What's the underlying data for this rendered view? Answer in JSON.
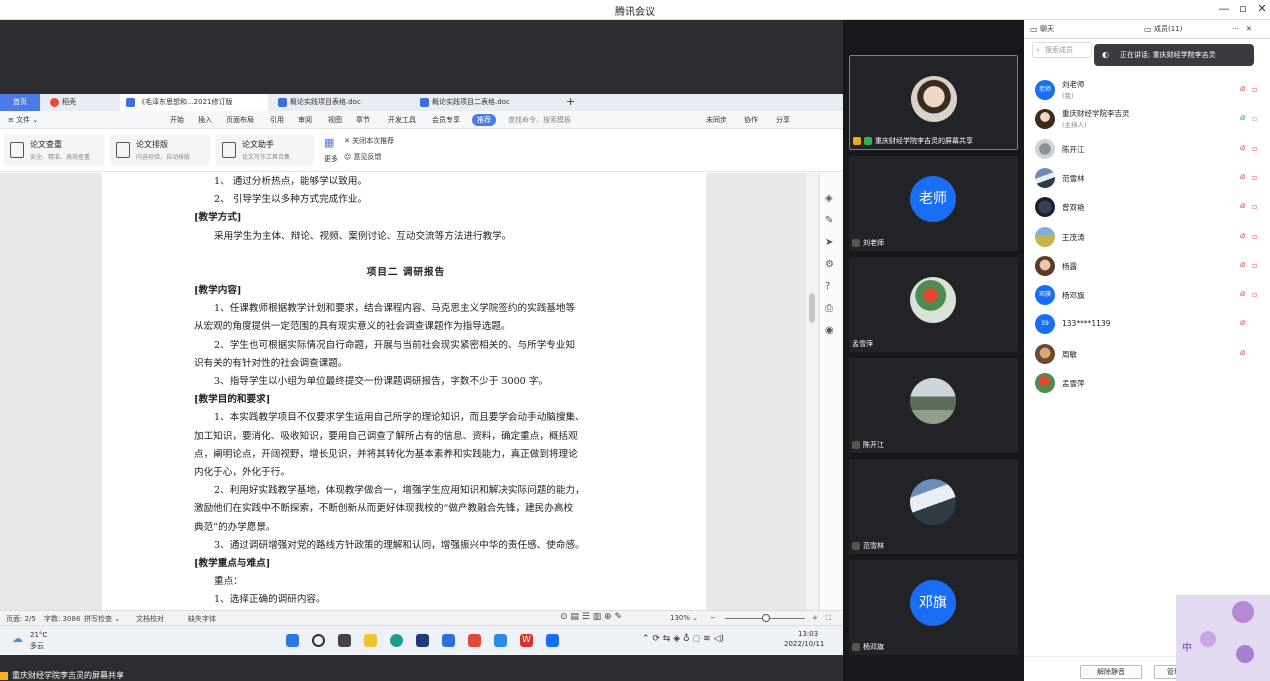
{
  "window": {
    "title": "腾讯会议",
    "controls": {
      "minimize": "—",
      "restore": "▫",
      "close": "✕"
    }
  },
  "wps": {
    "tabs": [
      {
        "label": "首页"
      },
      {
        "label": "稻壳"
      },
      {
        "label": "《毛泽东思想和...2021修订版"
      },
      {
        "label": "概论实践项目表格.doc"
      },
      {
        "label": "概论实践项目二表格.doc"
      }
    ],
    "add_tab": "+",
    "menu": {
      "file": "≡ 文件 ⌄",
      "items": [
        "开始",
        "插入",
        "页面布局",
        "引用",
        "审阅",
        "视图",
        "章节",
        "开发工具",
        "会员专享"
      ],
      "recommend": "推荐",
      "search": "查找命令、搜索模板",
      "sync": "未同步",
      "collab": "协作",
      "share": "分享"
    },
    "ribbon": {
      "btn1_title": "论文查重",
      "btn1_sub": "安全、精准、高效查重",
      "btn2_title": "论文排版",
      "btn2_sub": "内容校验，自动排版",
      "btn3_title": "论文助手",
      "btn3_sub": "论文写作工具合集",
      "more": "更多",
      "close_rec": "关闭本次推荐",
      "feedback": "意见反馈"
    },
    "doc_lines": [
      {
        "text": "1、 通过分析热点，能够学以致用。",
        "cls": "ind"
      },
      {
        "text": "2、 引导学生以多种方式完成作业。",
        "cls": "ind"
      },
      {
        "text": "[教学方式]",
        "cls": "h"
      },
      {
        "text": "采用学生为主体、辩论、视频、案例讨论、互动交流等方法进行教学。",
        "cls": "ind"
      },
      {
        "text": "",
        "cls": "blank"
      },
      {
        "text": "项目二        调研报告",
        "cls": "ctr"
      },
      {
        "text": "[教学内容]",
        "cls": "h"
      },
      {
        "text": "1、任课教师根据教学计划和要求，结合课程内容、马克思主义学院签约的实践基地等",
        "cls": "ind"
      },
      {
        "text": "从宏观的角度提供一定范围的具有现实意义的社会调查课题作为指导选题。",
        "cls": ""
      },
      {
        "text": "2、学生也可根据实际情况自行命题，开展与当前社会现实紧密相关的、与所学专业知",
        "cls": "ind"
      },
      {
        "text": "识有关的有针对性的社会调查课题。",
        "cls": ""
      },
      {
        "text": "3、指导学生以小组为单位最终提交一份课题调研报告，字数不少于 3000 字。",
        "cls": "ind"
      },
      {
        "text": "[教学目的和要求]",
        "cls": "h"
      },
      {
        "text": "1、本实践教学项目不仅要求学生运用自己所学的理论知识，而且要学会动手动脑搜集、",
        "cls": "ind"
      },
      {
        "text": "加工知识，要消化、吸收知识，要用自己调查了解所占有的信息、资料，确定重点，概括观",
        "cls": ""
      },
      {
        "text": "点，阐明论点，开阔视野，增长见识，并将其转化为基本素养和实践能力，真正做到将理论",
        "cls": ""
      },
      {
        "text": "内化于心，外化于行。",
        "cls": ""
      },
      {
        "text": "2、利用好实践教学基地，体现教学做合一，增强学生应用知识和解决实际问题的能力，",
        "cls": "ind"
      },
      {
        "text": "激励他们在实践中不断探索，不断创新从而更好体现我校的“做产教融合先锋，建民办高校",
        "cls": ""
      },
      {
        "text": "典范”的办学愿景。",
        "cls": ""
      },
      {
        "text": "3、通过调研增强对党的路线方针政策的理解和认同，增强振兴中华的责任感、使命感。",
        "cls": "ind"
      },
      {
        "text": "[教学重点与难点]",
        "cls": "h"
      },
      {
        "text": "重点：",
        "cls": "ind"
      },
      {
        "text": "1、选择正确的调研内容。",
        "cls": "ind"
      }
    ],
    "status": {
      "page": "页面: 2/5",
      "words": "字数: 3086",
      "spell": "拼写检查 ⌄",
      "proof": "文档校对",
      "font": "缺失字体",
      "zoom": "130% ⌄"
    }
  },
  "taskbar": {
    "temp": "21°C",
    "weather": "多云",
    "time": "13:03",
    "date": "2022/10/11"
  },
  "share_caption": "重庆财经学院李吉灵的屏幕共享",
  "videos": [
    {
      "name": "重庆财经学院李吉灵的屏幕共享",
      "avatar_text": ""
    },
    {
      "name": "刘老师",
      "avatar_text": "老师"
    },
    {
      "name": "孟雪萍",
      "avatar_text": ""
    },
    {
      "name": "陈开江",
      "avatar_text": ""
    },
    {
      "name": "范雪林",
      "avatar_text": ""
    },
    {
      "name": "杨邓旗",
      "avatar_text": "邓旗"
    }
  ],
  "panel": {
    "tab_chat": "聊天",
    "tab_members": "成员(11)",
    "more": "···",
    "close": "✕",
    "search_placeholder": "搜索成员",
    "speaking": "正在讲话: 重庆财经学院李吉灵",
    "members": [
      {
        "name": "刘老师",
        "sub": "(我)",
        "avatar_text": "老师"
      },
      {
        "name": "重庆财经学院李吉灵",
        "sub": "(主持人)",
        "avatar_text": ""
      },
      {
        "name": "陈开江",
        "sub": "",
        "avatar_text": ""
      },
      {
        "name": "范雪林",
        "sub": "",
        "avatar_text": ""
      },
      {
        "name": "曾双艳",
        "sub": "",
        "avatar_text": ""
      },
      {
        "name": "王茂涛",
        "sub": "",
        "avatar_text": ""
      },
      {
        "name": "杨露",
        "sub": "",
        "avatar_text": ""
      },
      {
        "name": "杨邓旗",
        "sub": "",
        "avatar_text": "邓旗"
      },
      {
        "name": "133****1139",
        "sub": "",
        "avatar_text": "39"
      },
      {
        "name": "周敏",
        "sub": "",
        "avatar_text": ""
      },
      {
        "name": "孟雪萍",
        "sub": "",
        "avatar_text": ""
      }
    ],
    "btn_unmute_all": "解除静音",
    "btn_more": "管理",
    "deco_text": "中"
  }
}
